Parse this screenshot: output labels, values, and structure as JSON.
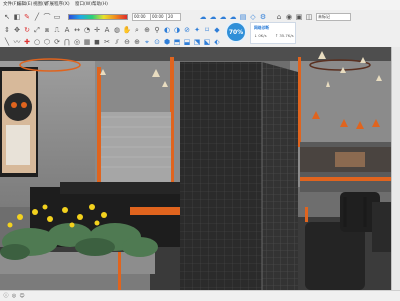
{
  "menu": {
    "items": [
      "文件(F)",
      "编辑(E)",
      "视图(V)",
      "扩展程序(X)",
      "窗口(W)",
      "帮助(H)"
    ]
  },
  "toolbar": {
    "value_field": "00:00",
    "value_field2": "00:00",
    "angle_field": "20",
    "dropdown_label": "未标记",
    "percent": "70%",
    "net_title": "网络诊断",
    "net_down": "↓ 0K/s",
    "net_up": "↑ 35.7K/s"
  },
  "colors": {
    "accent": "#2f8fd8",
    "orange_strip": "#e0641e",
    "wall": "#8e8e8e"
  },
  "icons": [
    "select-icon",
    "eraser-icon",
    "paint-icon",
    "line-icon",
    "arc-icon",
    "rectangle-icon",
    "push-pull-icon",
    "move-icon",
    "rotate-icon",
    "scale-icon",
    "offset-icon",
    "tape-icon",
    "text-icon",
    "orbit-icon",
    "pan-icon",
    "zoom-icon",
    "zoom-extents-icon",
    "cloud-icon",
    "home-icon",
    "settings-icon",
    "component-icon",
    "style-icon",
    "shadow-icon",
    "section-icon"
  ]
}
